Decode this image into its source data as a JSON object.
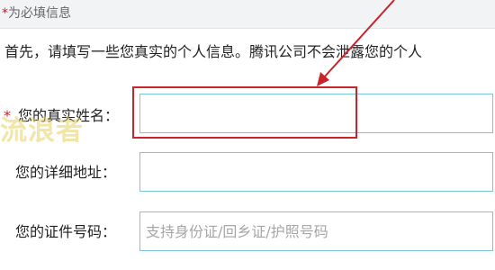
{
  "header": {
    "required_star": "*",
    "required_note": "为必填信息"
  },
  "intro_text": "首先，请填写一些您真实的个人信息。腾讯公司不会泄露您的个人",
  "form": {
    "name": {
      "star": "*",
      "label": "您的真实姓名：",
      "value": ""
    },
    "address": {
      "label": "您的详细地址：",
      "value": ""
    },
    "id_number": {
      "label": "您的证件号码：",
      "placeholder": "支持身份证/回乡证/护照号码",
      "value": ""
    }
  },
  "watermark_text": "流浪者",
  "colors": {
    "accent_input_border": "#78c9d6",
    "annotation_red": "#c8242b",
    "required_red": "#e0141e"
  }
}
